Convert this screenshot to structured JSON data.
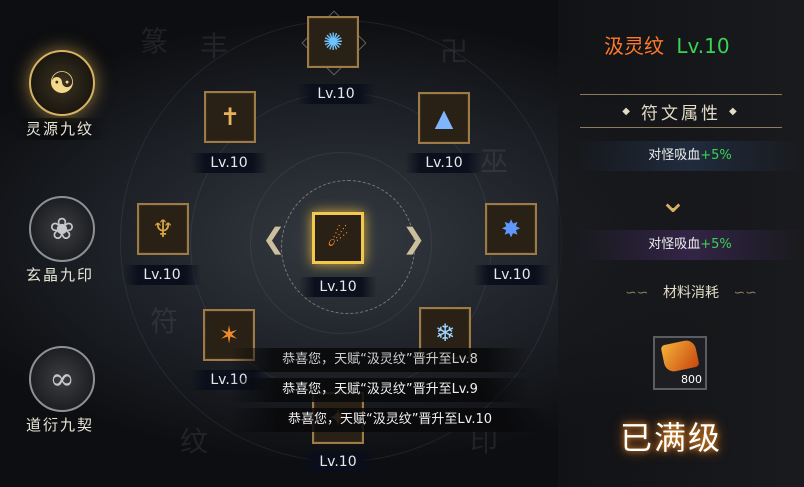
{
  "nav": [
    {
      "label": "灵源九纹",
      "glyph": "☯",
      "icon": "spirit-source-emblem-icon",
      "active": true
    },
    {
      "label": "玄晶九印",
      "glyph": "❀",
      "icon": "mystic-crystal-emblem-icon",
      "active": false
    },
    {
      "label": "道衍九契",
      "glyph": "∞",
      "icon": "dao-contract-emblem-icon",
      "active": false
    }
  ],
  "nodes": [
    {
      "id": "top",
      "level": "Lv.10",
      "glyph": "✺",
      "icon": "blue-swirl-rune-icon",
      "color": "#6ec3ff"
    },
    {
      "id": "upper-left",
      "level": "Lv.10",
      "glyph": "✝",
      "icon": "golden-sword-rune-icon",
      "color": "#e6b35c"
    },
    {
      "id": "upper-right",
      "level": "Lv.10",
      "glyph": "▲",
      "icon": "blue-crystal-rune-icon",
      "color": "#7fb4ff"
    },
    {
      "id": "left",
      "level": "Lv.10",
      "glyph": "♆",
      "icon": "golden-chalice-rune-icon",
      "color": "#d9a441"
    },
    {
      "id": "center",
      "level": "Lv.10",
      "glyph": "☄",
      "icon": "fire-comet-rune-icon",
      "color": "#ff8a1e",
      "selected": true
    },
    {
      "id": "right",
      "level": "Lv.10",
      "glyph": "✸",
      "icon": "blue-burst-rune-icon",
      "color": "#5f97ff"
    },
    {
      "id": "lower-left",
      "level": "Lv.10",
      "glyph": "✶",
      "icon": "orange-flame-rune-icon",
      "color": "#f08a2a"
    },
    {
      "id": "lower-right",
      "level": "",
      "glyph": "❄",
      "icon": "ice-blade-rune-icon",
      "color": "#9ed4ff"
    },
    {
      "id": "bottom",
      "level": "Lv.10",
      "glyph": "✦",
      "icon": "golden-rune-icon",
      "color": "#d8a24a"
    }
  ],
  "toasts": [
    "恭喜您，天赋“汲灵纹”晋升至Lv.8",
    "恭喜您，天赋“汲灵纹”晋升至Lv.9",
    "恭喜您，天赋“汲灵纹”晋升至Lv.10"
  ],
  "panel": {
    "name": "汲灵纹",
    "level": "Lv.10",
    "name_color": "#ff7a2a",
    "level_color": "#39d353",
    "header": "符文属性",
    "attr1_label": "对怪吸血",
    "attr1_value": "+5%",
    "attr2_label": "对怪吸血",
    "attr2_value": "+5%",
    "value_color": "#39d353",
    "material_title": "材料消耗",
    "material_count": "800",
    "material_icon": "scroll-material-icon",
    "maxed_label": "已满级"
  }
}
